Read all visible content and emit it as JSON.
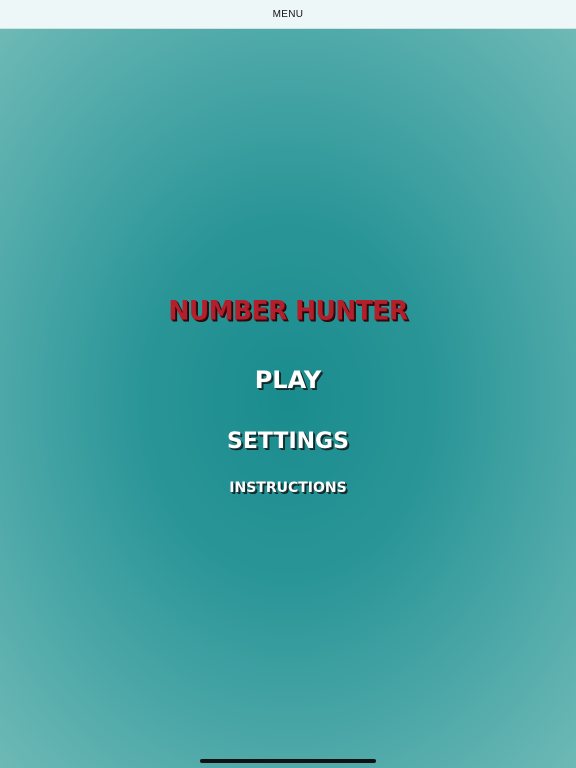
{
  "top_bar": {
    "title": "MENU"
  },
  "game": {
    "title": "NUMBER HUNTER",
    "title_color": "#b3202b"
  },
  "menu": {
    "play_label": "PLAY",
    "settings_label": "SETTINGS",
    "instructions_label": "INSTRUCTIONS"
  },
  "theme": {
    "background_center": "#1a8c8e",
    "background_edge": "#6fbab6",
    "text_color": "#ffffff"
  }
}
